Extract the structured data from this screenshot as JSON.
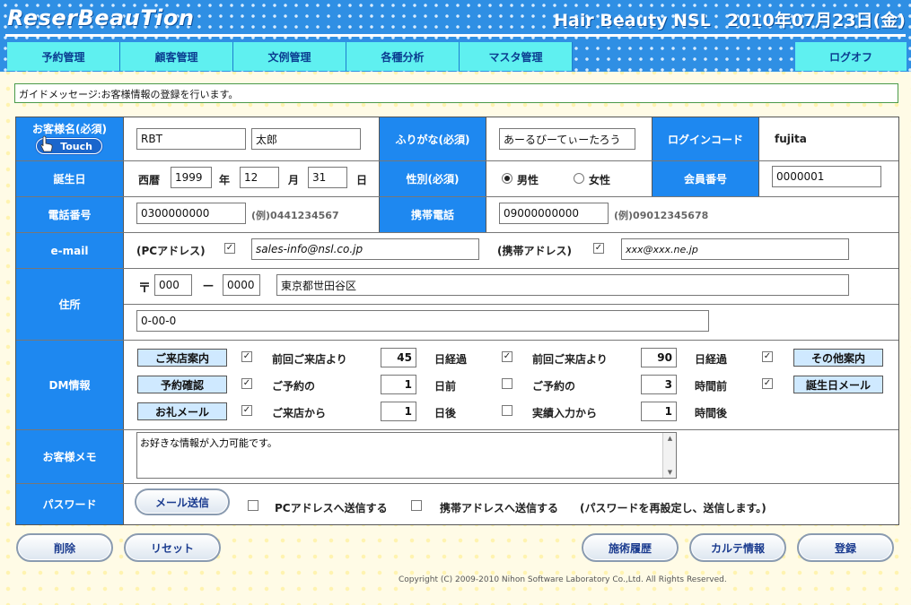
{
  "header": {
    "logo": "ReserBeauTion",
    "shop_name": "Hair Beauty NSL",
    "date": "2010年07月23日(金)"
  },
  "nav": {
    "tabs": [
      "予約管理",
      "顧客管理",
      "文例管理",
      "各種分析",
      "マスタ管理"
    ],
    "logout": "ログオフ"
  },
  "guide": {
    "message": "ガイドメッセージ:お客様情報の登録を行います。"
  },
  "form": {
    "name_label": "お客様名(必須)",
    "touch_label": "Touch",
    "last_name": "RBT",
    "first_name": "太郎",
    "furigana_label": "ふりがな(必須)",
    "furigana": "あーるびーてぃーたろう",
    "login_label": "ログインコード",
    "login_code": "fujita",
    "birthday_label": "誕生日",
    "era_label": "西暦",
    "year": "1999",
    "year_unit": "年",
    "month": "12",
    "month_unit": "月",
    "day": "31",
    "day_unit": "日",
    "gender_label": "性別(必須)",
    "gender_male": "男性",
    "gender_female": "女性",
    "member_label": "会員番号",
    "member_no": "0000001",
    "phone_label": "電話番号",
    "phone": "0300000000",
    "phone_example": "(例)0441234567",
    "mobile_label": "携帯電話",
    "mobile": "09000000000",
    "mobile_example": "(例)09012345678",
    "email_label": "e-mail",
    "pc_label": "(PCアドレス)",
    "pc_email": "sales-info@nsl.co.jp",
    "mobile_addr_label": "(携帯アドレス)",
    "mobile_email": "xxx@xxx.ne.jp",
    "address_label": "住所",
    "postal_mark": "〒",
    "zip1": "000",
    "zip_dash": "—",
    "zip2": "0000",
    "address1": "東京都世田谷区",
    "address2": "0-00-0"
  },
  "dm": {
    "label": "DM情報",
    "rows": [
      {
        "tag": "ご来店案内",
        "t1": "前回ご来店より",
        "v1": "45",
        "u1": "日経過",
        "t2": "前回ご来店より",
        "v2": "90",
        "u2": "日経過",
        "tag2": "その他案内"
      },
      {
        "tag": "予約確認",
        "t1": "ご予約の",
        "v1": "1",
        "u1": "日前",
        "t2": "ご予約の",
        "v2": "3",
        "u2": "時間前",
        "tag2": "誕生日メール"
      },
      {
        "tag": "お礼メール",
        "t1": "ご来店から",
        "v1": "1",
        "u1": "日後",
        "t2": "実績入力から",
        "v2": "1",
        "u2": "時間後",
        "tag2": ""
      }
    ]
  },
  "memo": {
    "label": "お客様メモ",
    "text": "お好きな情報が入力可能です。"
  },
  "password": {
    "label": "パスワード",
    "send_button": "メール送信",
    "to_pc": "PCアドレスへ送信する",
    "to_mobile": "携帯アドレスへ送信する",
    "note": "(パスワードを再設定し、送信します。)"
  },
  "buttons": {
    "delete": "削除",
    "reset": "リセット",
    "history": "施術履歴",
    "karte": "カルテ情報",
    "register": "登録"
  },
  "footer": {
    "copyright": "Copyright (C) 2009-2010 Nihon Software Laboratory Co.,Ltd. All Rights Reserved."
  },
  "colors": {
    "header_blue": "#2f8fe4",
    "nav_cyan": "#5ff0f0",
    "label_blue": "#1e88f0"
  }
}
